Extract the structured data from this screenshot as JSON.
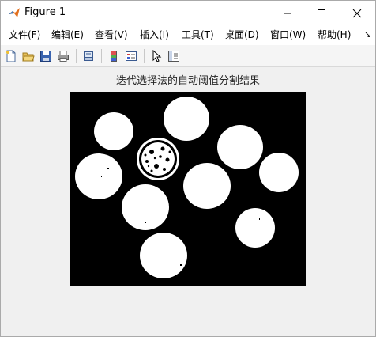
{
  "window": {
    "title": "Figure 1"
  },
  "menu": {
    "items": [
      {
        "key": "file",
        "label": "文件(F)"
      },
      {
        "key": "edit",
        "label": "编辑(E)"
      },
      {
        "key": "view",
        "label": "查看(V)"
      },
      {
        "key": "insert",
        "label": "插入(I)"
      },
      {
        "key": "tools",
        "label": "工具(T)"
      },
      {
        "key": "desktop",
        "label": "桌面(D)"
      },
      {
        "key": "window",
        "label": "窗口(W)"
      },
      {
        "key": "help",
        "label": "帮助(H)"
      }
    ]
  },
  "toolbar": {
    "icons": [
      "new-figure-icon",
      "open-file-icon",
      "save-icon",
      "print-icon",
      "link-axes-icon",
      "insert-colorbar-icon",
      "insert-legend-icon",
      "edit-plot-pointer-icon",
      "property-inspector-icon"
    ]
  },
  "figure": {
    "title": "迭代选择法的自动阈值分割结果"
  },
  "colors": {
    "background": "#f0f0f0",
    "plot_background": "#000000",
    "objects": "#ffffff"
  }
}
